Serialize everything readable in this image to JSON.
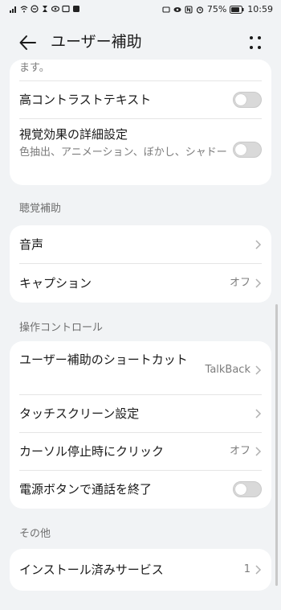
{
  "status_bar": {
    "battery": "75%",
    "time": "10:59"
  },
  "app_bar": {
    "title": "ユーザー補助"
  },
  "card_display": {
    "partial_text": "ます。",
    "high_contrast_label": "高コントラストテキスト",
    "visual_effects_label": "視覚効果の詳細設定",
    "visual_effects_sub": "色抽出、アニメーション、ぼかし、シャドー"
  },
  "section_hearing": {
    "header": "聴覚補助",
    "sound_label": "音声",
    "caption_label": "キャプション",
    "caption_value": "オフ"
  },
  "section_control": {
    "header": "操作コントロール",
    "shortcut_label": "ユーザー補助のショートカット",
    "shortcut_value": "TalkBack",
    "touchscreen_label": "タッチスクリーン設定",
    "cursor_click_label": "カーソル停止時にクリック",
    "cursor_click_value": "オフ",
    "power_end_call_label": "電源ボタンで通話を終了"
  },
  "section_other": {
    "header": "その他",
    "installed_services_label": "インストール済みサービス",
    "installed_services_value": "1"
  },
  "colors": {
    "background": "#f1f3f5",
    "card": "#ffffff",
    "toggle_off": "#d9d9d9",
    "secondary_text": "#7c7c7c"
  }
}
